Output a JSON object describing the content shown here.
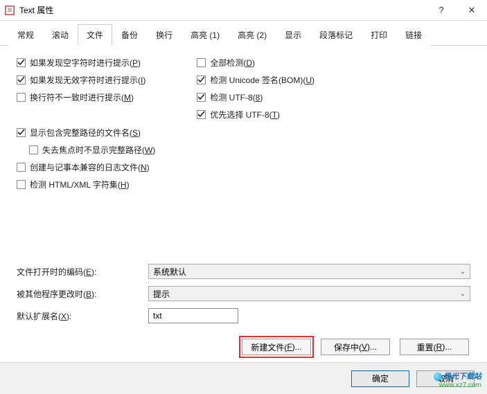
{
  "window": {
    "title": "Text 属性",
    "help": "?",
    "close": "✕"
  },
  "tabs": [
    {
      "label": "常规",
      "active": false
    },
    {
      "label": "滚动",
      "active": false
    },
    {
      "label": "文件",
      "active": true
    },
    {
      "label": "备份",
      "active": false
    },
    {
      "label": "换行",
      "active": false
    },
    {
      "label": "高亮 (1)",
      "active": false
    },
    {
      "label": "高亮 (2)",
      "active": false
    },
    {
      "label": "显示",
      "active": false
    },
    {
      "label": "段落标记",
      "active": false
    },
    {
      "label": "打印",
      "active": false
    },
    {
      "label": "链接",
      "active": false
    }
  ],
  "left_checks": [
    {
      "label": "如果发现空字符时进行提示(",
      "hot": "P",
      "suffix": ")",
      "checked": true,
      "indent": false
    },
    {
      "label": "如果发现无效字符时进行提示(",
      "hot": "I",
      "suffix": ")",
      "checked": true,
      "indent": false
    },
    {
      "label": "换行符不一致时进行提示(",
      "hot": "M",
      "suffix": ")",
      "checked": false,
      "indent": false
    },
    {
      "label": "显示包含完整路径的文件名(",
      "hot": "S",
      "suffix": ")",
      "checked": true,
      "indent": false
    },
    {
      "label": "失去焦点时不显示完整路径(",
      "hot": "W",
      "suffix": ")",
      "checked": false,
      "indent": true
    },
    {
      "label": "创建与记事本兼容的日志文件(",
      "hot": "N",
      "suffix": ")",
      "checked": false,
      "indent": false
    },
    {
      "label": "检测 HTML/XML 字符集(",
      "hot": "H",
      "suffix": ")",
      "checked": false,
      "indent": false
    }
  ],
  "right_checks": [
    {
      "label": "全部检测(",
      "hot": "D",
      "suffix": ")",
      "checked": false
    },
    {
      "label": "检测 Unicode 签名(BOM)(",
      "hot": "U",
      "suffix": ")",
      "checked": true
    },
    {
      "label": "检测 UTF-8(",
      "hot": "8",
      "suffix": ")",
      "checked": true
    },
    {
      "label": "优先选择 UTF-8(",
      "hot": "T",
      "suffix": ")",
      "checked": true
    }
  ],
  "form": {
    "encoding_label": "文件打开时的编码(",
    "encoding_hot": "E",
    "encoding_suffix": "):",
    "encoding_value": "系统默认",
    "modified_label": "被其他程序更改时(",
    "modified_hot": "B",
    "modified_suffix": "):",
    "modified_value": "提示",
    "ext_label": "默认扩展名(",
    "ext_hot": "X",
    "ext_suffix": "):",
    "ext_value": "txt"
  },
  "buttons": {
    "new_file": "新建文件(",
    "new_file_hot": "F",
    "new_file_suffix": ")...",
    "saving": "保存中(",
    "saving_hot": "V",
    "saving_suffix": ")...",
    "reset": "重置(",
    "reset_hot": "R",
    "reset_suffix": ")..."
  },
  "footer": {
    "ok": "确定",
    "cancel": "取消"
  },
  "watermark": {
    "line1": "极光下载站",
    "line2": "www.xz7.com"
  }
}
